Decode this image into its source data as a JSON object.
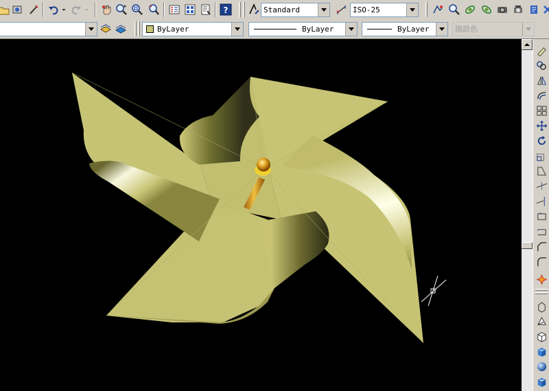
{
  "toolbar": {
    "text_style": "Standard",
    "dim_style": "ISO-25"
  },
  "properties": {
    "layer_value": "",
    "color": "ByLayer",
    "color_swatch": "#c8c478",
    "linetype": "ByLayer",
    "lineweight": "ByLayer",
    "plot_style": "随颜色"
  },
  "icons": {
    "toolbar_top": [
      "open-icon",
      "publish-icon",
      "match-properties-icon",
      "undo-icon",
      "redo-icon",
      "pan-icon",
      "zoom-realtime-icon",
      "zoom-window-icon",
      "zoom-previous-icon",
      "properties-icon",
      "design-center-icon",
      "tool-palettes-icon",
      "help-icon",
      "text-style-icon",
      "dim-style-icon",
      "layer-states-icon",
      "zoom-icon",
      "orbit-icon",
      "swivel-icon",
      "camera-icon",
      "walk-icon",
      "render-icon"
    ],
    "modify_toolbar": [
      "erase-icon",
      "copy-icon",
      "mirror-icon",
      "offset-icon",
      "array-icon",
      "move-icon",
      "rotate-icon",
      "scale-icon",
      "stretch-icon",
      "trim-icon",
      "extend-icon",
      "break-icon",
      "join-icon",
      "chamfer-icon",
      "fillet-icon",
      "explode-icon"
    ],
    "solids_toolbar": [
      "box-wire-icon",
      "wedge-icon",
      "box-icon",
      "box-shaded-icon",
      "sphere-icon",
      "cube-icon"
    ]
  },
  "colors": {
    "model_space_background": "#000000",
    "solid_color": "#c8c474",
    "ui_face": "#d4d0c8"
  }
}
